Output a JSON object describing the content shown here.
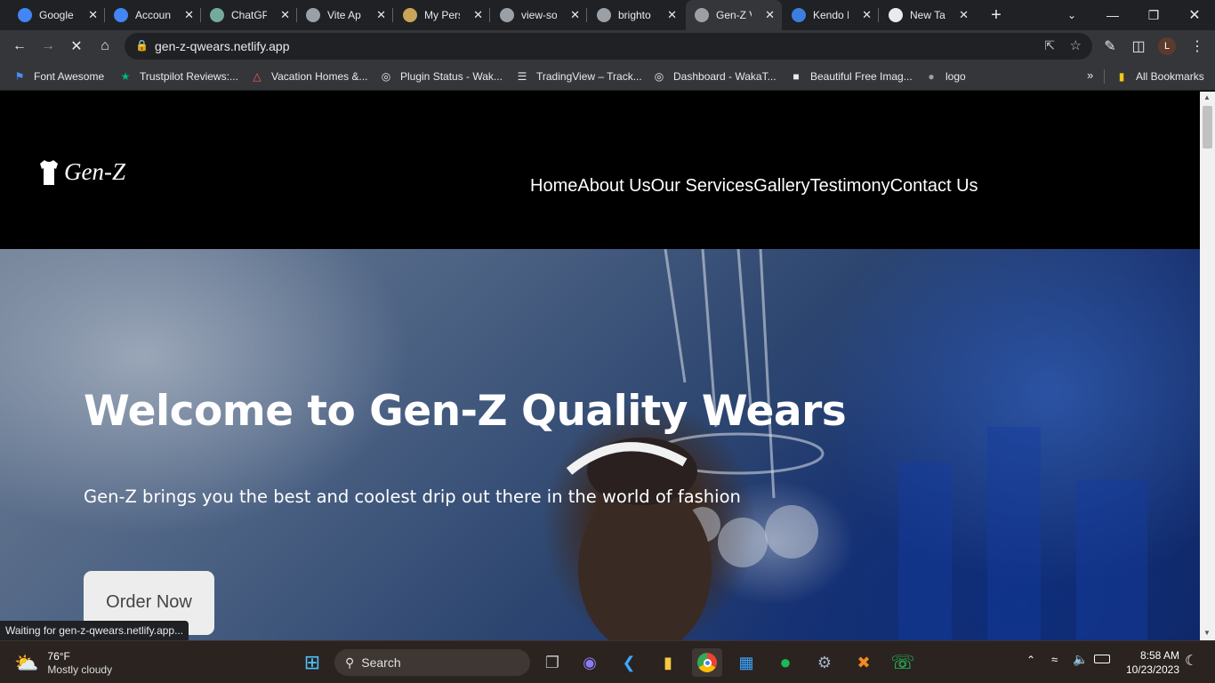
{
  "browser": {
    "tabs": [
      {
        "title": "Google",
        "icon": "google-icon",
        "color": "#4285f4"
      },
      {
        "title": "Accoun",
        "icon": "google-icon",
        "color": "#4285f4"
      },
      {
        "title": "ChatGP",
        "icon": "openai-icon",
        "color": "#74aa9c"
      },
      {
        "title": "Vite Ap",
        "icon": "globe-icon",
        "color": "#9aa0a6"
      },
      {
        "title": "My Pers",
        "icon": "portfolio-icon",
        "color": "#c9a55a"
      },
      {
        "title": "view-so",
        "icon": "globe-icon",
        "color": "#9aa0a6"
      },
      {
        "title": "brighto",
        "icon": "globe-icon",
        "color": "#9aa0a6"
      },
      {
        "title": "Gen-Z V",
        "icon": "loading-icon",
        "color": "#9aa0a6",
        "active": true
      },
      {
        "title": "Kendo I",
        "icon": "kendo-icon",
        "color": "#3c7ee0"
      },
      {
        "title": "New Ta",
        "icon": "chrome-icon",
        "color": "#e8eaed"
      }
    ],
    "new_tab_label": "+",
    "url": "gen-z-qwears.netlify.app",
    "profile_initial": "L",
    "bookmarks": [
      {
        "label": "Font Awesome",
        "icon": "flag-icon"
      },
      {
        "label": "Trustpilot Reviews:...",
        "icon": "star-icon"
      },
      {
        "label": "Vacation Homes &...",
        "icon": "airbnb-icon"
      },
      {
        "label": "Plugin Status - Wak...",
        "icon": "wakatime-icon"
      },
      {
        "label": "TradingView – Track...",
        "icon": "tradingview-icon"
      },
      {
        "label": "Dashboard - WakaT...",
        "icon": "wakatime-icon"
      },
      {
        "label": "Beautiful Free Imag...",
        "icon": "unsplash-icon"
      },
      {
        "label": "logo",
        "icon": "globe-icon"
      }
    ],
    "all_bookmarks_label": "All Bookmarks",
    "status_text": "Waiting for gen-z-qwears.netlify.app..."
  },
  "site": {
    "logo_text": "Gen-Z",
    "nav": [
      "Home",
      "About Us",
      "Our Services",
      "Gallery",
      "Testimony",
      "Contact Us"
    ],
    "hero_title": "Welcome to Gen-Z Quality Wears",
    "hero_subtitle": "Gen-Z brings you the best and coolest drip out there in the world of fashion",
    "cta_label": "Order Now"
  },
  "taskbar": {
    "weather_temp": "76°F",
    "weather_desc": "Mostly cloudy",
    "search_label": "Search",
    "time": "8:58 AM",
    "date": "10/23/2023"
  },
  "colors": {
    "tab_bg": "#202124",
    "toolbar_bg": "#35363a",
    "page_header_bg": "#000000",
    "cta_bg": "#ededed"
  }
}
